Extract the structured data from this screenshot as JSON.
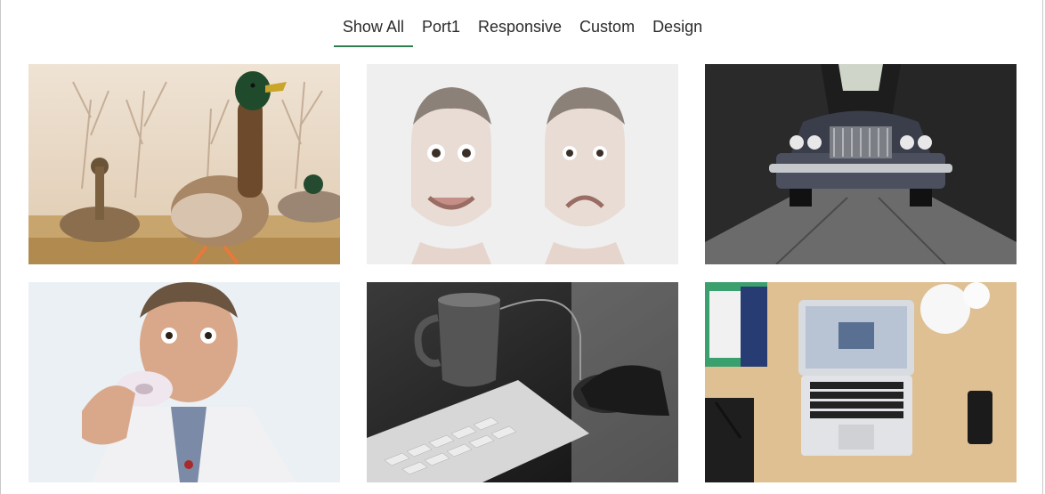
{
  "filters": {
    "items": [
      {
        "label": "Show All",
        "active": true
      },
      {
        "label": "Port1",
        "active": false
      },
      {
        "label": "Responsive",
        "active": false
      },
      {
        "label": "Custom",
        "active": false
      },
      {
        "label": "Design",
        "active": false
      }
    ],
    "accent_color": "#2e7d4f"
  },
  "gallery": {
    "items": [
      {
        "subject": "ducks walking",
        "icon": "duck-photo"
      },
      {
        "subject": "two faces happy and sad",
        "icon": "faces-photo"
      },
      {
        "subject": "vintage car in alley",
        "icon": "car-photo"
      },
      {
        "subject": "man eating donut",
        "icon": "donut-man-photo"
      },
      {
        "subject": "mug, keyboard and mouse",
        "icon": "desk-keyboard-photo"
      },
      {
        "subject": "laptop on wooden desk",
        "icon": "laptop-desk-photo"
      }
    ]
  }
}
